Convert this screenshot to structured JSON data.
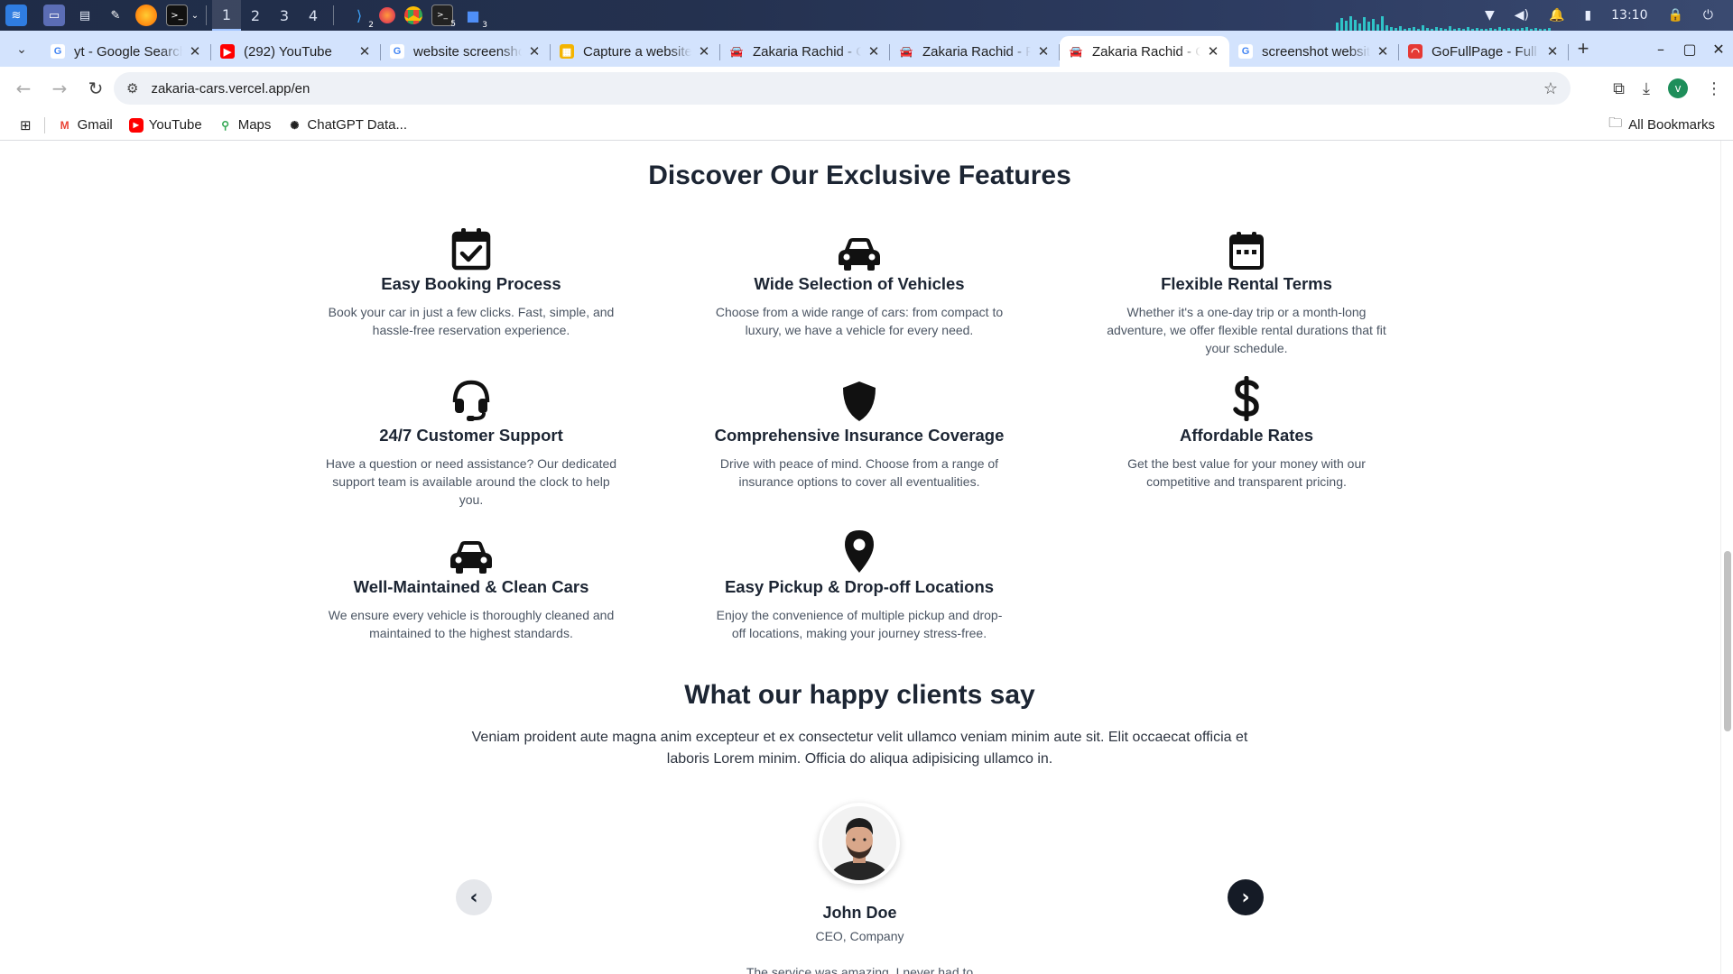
{
  "taskbar": {
    "workspaces": [
      "1",
      "2",
      "3",
      "4"
    ],
    "badges": {
      "vscode": "2",
      "terminal": "5",
      "files": "3"
    },
    "clock": "13:10"
  },
  "browser": {
    "tabs": [
      {
        "title": "yt - Google Search",
        "favicon": "google-icon"
      },
      {
        "title": "(292) YouTube",
        "favicon": "youtube-icon"
      },
      {
        "title": "website screenshot",
        "favicon": "google-icon"
      },
      {
        "title": "Capture a website",
        "favicon": "grid-app-icon"
      },
      {
        "title": "Zakaria Rachid - Car",
        "favicon": "car-icon"
      },
      {
        "title": "Zakaria Rachid - Premium",
        "favicon": "car-icon"
      },
      {
        "title": "Zakaria Rachid - Car",
        "favicon": "car-icon",
        "active": true
      },
      {
        "title": "screenshot website",
        "favicon": "google-icon"
      },
      {
        "title": "GoFullPage - Full Page",
        "favicon": "gofullpage-icon"
      }
    ],
    "url": "zakaria-cars.vercel.app/en",
    "profile_initial": "v",
    "bookmarks": [
      {
        "label": "Gmail",
        "icon": "gmail-icon"
      },
      {
        "label": "YouTube",
        "icon": "youtube-icon"
      },
      {
        "label": "Maps",
        "icon": "maps-icon"
      },
      {
        "label": "ChatGPT Data...",
        "icon": "chatgpt-icon"
      }
    ],
    "all_bookmarks": "All Bookmarks"
  },
  "features": {
    "title": "Discover Our Exclusive Features",
    "items": [
      {
        "name": "Easy Booking Process",
        "desc": "Book your car in just a few clicks. Fast, simple, and hassle-free reservation experience.",
        "icon": "calendar-check-icon"
      },
      {
        "name": "Wide Selection of Vehicles",
        "desc": "Choose from a wide range of cars: from compact to luxury, we have a vehicle for every need.",
        "icon": "car-icon"
      },
      {
        "name": "Flexible Rental Terms",
        "desc": "Whether it's a one-day trip or a month-long adventure, we offer flexible rental durations that fit your schedule.",
        "icon": "calendar-icon"
      },
      {
        "name": "24/7 Customer Support",
        "desc": "Have a question or need assistance? Our dedicated support team is available around the clock to help you.",
        "icon": "headset-icon"
      },
      {
        "name": "Comprehensive Insurance Coverage",
        "desc": "Drive with peace of mind. Choose from a range of insurance options to cover all eventualities.",
        "icon": "shield-icon"
      },
      {
        "name": "Affordable Rates",
        "desc": "Get the best value for your money with our competitive and transparent pricing.",
        "icon": "dollar-icon"
      },
      {
        "name": "Well-Maintained & Clean Cars",
        "desc": "We ensure every vehicle is thoroughly cleaned and maintained to the highest standards.",
        "icon": "car-icon"
      },
      {
        "name": "Easy Pickup & Drop-off Locations",
        "desc": "Enjoy the convenience of multiple pickup and drop-off locations, making your journey stress-free.",
        "icon": "map-pin-icon"
      }
    ]
  },
  "testimonials": {
    "title": "What our happy clients say",
    "intro": "Veniam proident aute magna anim excepteur et ex consectetur velit ullamco veniam minim aute sit. Elit occaecat officia et laboris Lorem minim. Officia do aliqua adipisicing ullamco in.",
    "client": {
      "name": "John Doe",
      "role": "CEO, Company",
      "quote_partial": "The service was amazing. I never had to"
    }
  }
}
